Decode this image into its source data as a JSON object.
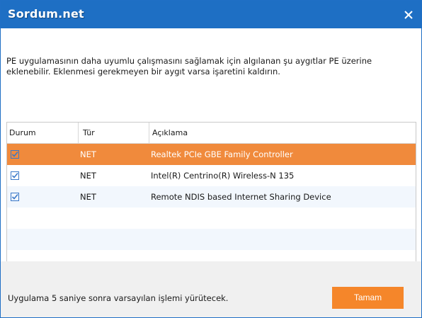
{
  "window": {
    "title": "Sordum.net",
    "accent_color": "#1e6fc4",
    "close_icon": "close-icon"
  },
  "description": "PE uygulamasının daha uyumlu çalışmasını sağlamak için algılanan şu aygıtlar PE üzerine eklenebilir. Eklenmesi gerekmeyen bir aygıt varsa işaretini kaldırın.",
  "table": {
    "columns": [
      "Durum",
      "Tür",
      "Açıklama"
    ],
    "rows": [
      {
        "checked": true,
        "type": "NET",
        "description": "Realtek PCIe GBE Family Controller",
        "selected": true
      },
      {
        "checked": true,
        "type": "NET",
        "description": "Intel(R) Centrino(R) Wireless-N 135",
        "selected": false
      },
      {
        "checked": true,
        "type": "NET",
        "description": "Remote NDIS based Internet Sharing Device",
        "selected": false
      }
    ],
    "selected_color": "#f08a3c",
    "checkbox_icon": "checkbox-checked-icon"
  },
  "footer": {
    "message": "Uygulama 5 saniye sonra varsayılan işlemi yürütecek.",
    "ok_label": "Tamam",
    "ok_color": "#f5862a"
  }
}
